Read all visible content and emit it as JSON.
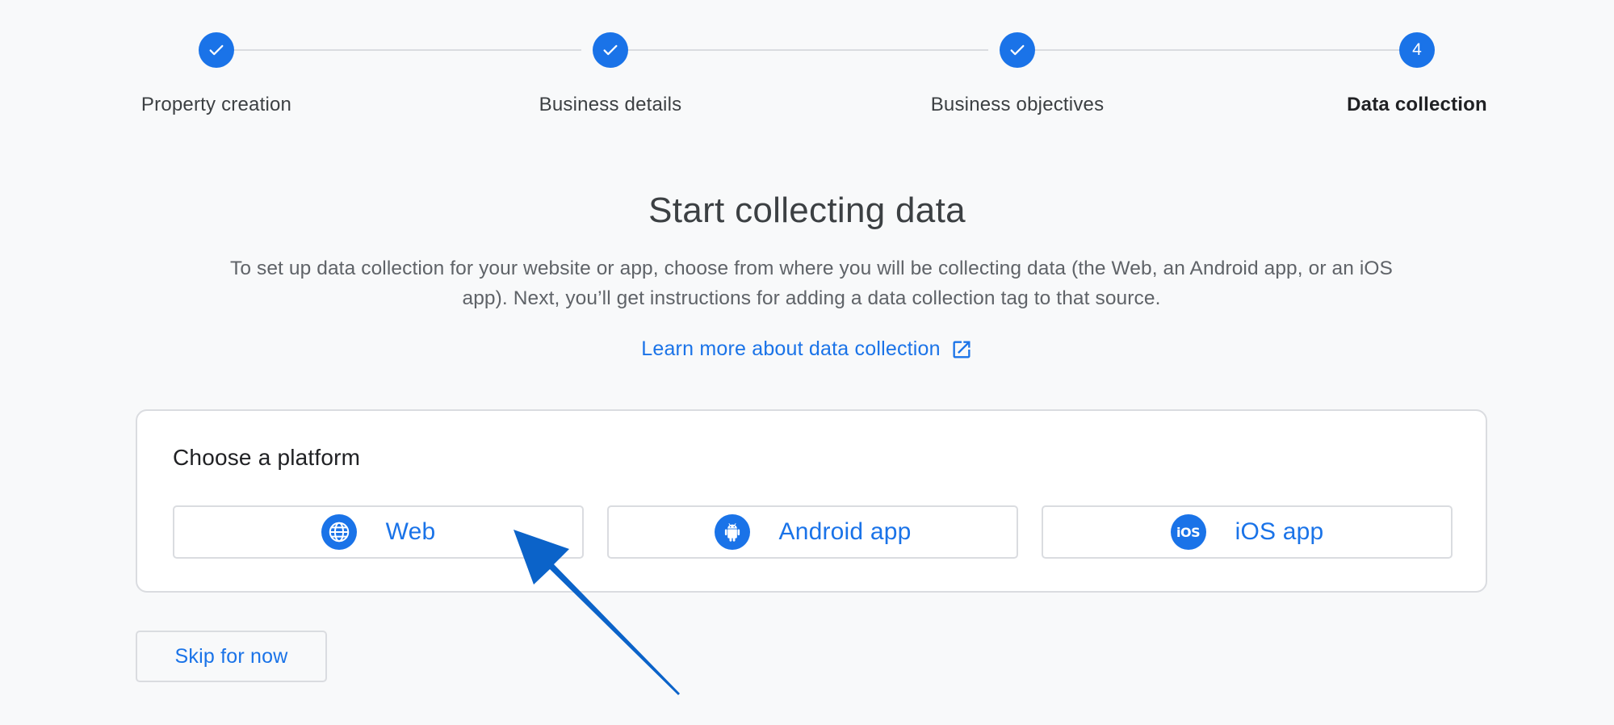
{
  "stepper": {
    "steps": [
      {
        "label": "Property creation",
        "state": "complete",
        "marker": ""
      },
      {
        "label": "Business details",
        "state": "complete",
        "marker": ""
      },
      {
        "label": "Business objectives",
        "state": "complete",
        "marker": ""
      },
      {
        "label": "Data collection",
        "state": "current",
        "marker": "4"
      }
    ]
  },
  "main": {
    "title": "Start collecting data",
    "description": "To set up data collection for your website or app, choose from where you will be collecting data (the Web, an Android app, or an iOS app). Next, you’ll get instructions for adding a data collection tag to that source.",
    "learn_more": {
      "label": "Learn more about data collection",
      "icon": "open-in-new-icon"
    }
  },
  "platform_card": {
    "title": "Choose a platform",
    "options": [
      {
        "label": "Web",
        "icon": "globe-icon"
      },
      {
        "label": "Android app",
        "icon": "android-icon"
      },
      {
        "label": "iOS app",
        "icon": "ios-icon",
        "glyph": "iOS"
      }
    ]
  },
  "footer": {
    "skip_label": "Skip for now"
  },
  "colors": {
    "accent": "#1a73e8",
    "background": "#f8f9fa",
    "border": "#dadce0",
    "annotation_arrow": "#0b63c9"
  }
}
